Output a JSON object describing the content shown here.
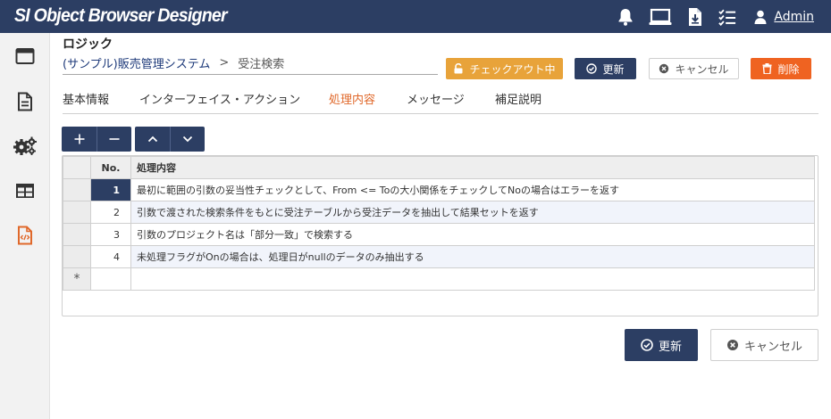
{
  "app": {
    "title": "SI Object Browser Designer"
  },
  "header": {
    "icons": [
      "bell-icon",
      "monitor-icon",
      "download-doc-icon",
      "checklist-icon"
    ],
    "user": {
      "name": "Admin"
    }
  },
  "sidebar": {
    "items": [
      {
        "name": "window",
        "icon": "window-icon"
      },
      {
        "name": "document",
        "icon": "document-icon"
      },
      {
        "name": "settings",
        "icon": "gears-icon"
      },
      {
        "name": "table",
        "icon": "table-icon"
      },
      {
        "name": "logic",
        "icon": "code-file-icon",
        "active": true
      }
    ]
  },
  "page": {
    "title": "ロジック",
    "breadcrumb": {
      "link": "(サンプル)販売管理システム",
      "separator": ">",
      "current": "受注検索"
    }
  },
  "actions": {
    "checkout": "チェックアウト中",
    "update": "更新",
    "cancel": "キャンセル",
    "delete": "削除"
  },
  "tabs": [
    {
      "label": "基本情報",
      "active": false
    },
    {
      "label": "インターフェイス・アクション",
      "active": false
    },
    {
      "label": "処理内容",
      "active": true
    },
    {
      "label": "メッセージ",
      "active": false
    },
    {
      "label": "補足説明",
      "active": false
    }
  ],
  "toolbar": {
    "add": "+",
    "remove": "−",
    "up_icon": "chevron-up-icon",
    "down_icon": "chevron-down-icon"
  },
  "grid": {
    "columns": {
      "no": "No.",
      "content": "処理内容"
    },
    "rows": [
      {
        "no": "1",
        "content": "最初に範囲の引数の妥当性チェックとして、From <= Toの大小関係をチェックしてNoの場合はエラーを返す"
      },
      {
        "no": "2",
        "content": "引数で渡された検索条件をもとに受注テーブルから受注データを抽出して結果セットを返す"
      },
      {
        "no": "3",
        "content": "引数のプロジェクト名は「部分一致」で検索する"
      },
      {
        "no": "4",
        "content": "未処理フラグがOnの場合は、処理日がnullのデータのみ抽出する"
      }
    ],
    "new_row_marker": "*"
  },
  "footer": {
    "update": "更新",
    "cancel": "キャンセル"
  },
  "colors": {
    "navy": "#2c3e63",
    "accent": "#e0682a",
    "warning": "#e8a33a",
    "danger": "#ef6321"
  }
}
